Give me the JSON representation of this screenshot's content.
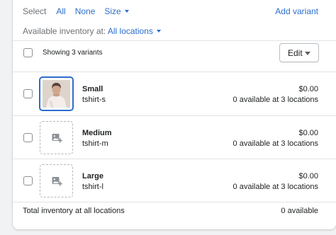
{
  "filters": {
    "select_label": "Select",
    "all": "All",
    "none": "None",
    "size": "Size",
    "add_variant": "Add variant"
  },
  "inventory": {
    "available_at_label": "Available inventory at:",
    "location": "All locations"
  },
  "list_header": {
    "showing": "Showing 3 variants",
    "edit_label": "Edit"
  },
  "variants": [
    {
      "name": "Small",
      "sku": "tshirt-s",
      "price": "$0.00",
      "availability": "0 available at 3 locations",
      "image": "product-photo"
    },
    {
      "name": "Medium",
      "sku": "tshirt-m",
      "price": "$0.00",
      "availability": "0 available at 3 locations",
      "image": "add-image-icon"
    },
    {
      "name": "Large",
      "sku": "tshirt-l",
      "price": "$0.00",
      "availability": "0 available at 3 locations",
      "image": "add-image-icon"
    }
  ],
  "footer": {
    "total_label": "Total inventory at all locations",
    "total_value": "0 available"
  },
  "colors": {
    "link": "#2c6ecb",
    "text": "#202223",
    "subdued": "#6d7175",
    "border": "#e1e3e5",
    "background": "#f1f2f3"
  }
}
